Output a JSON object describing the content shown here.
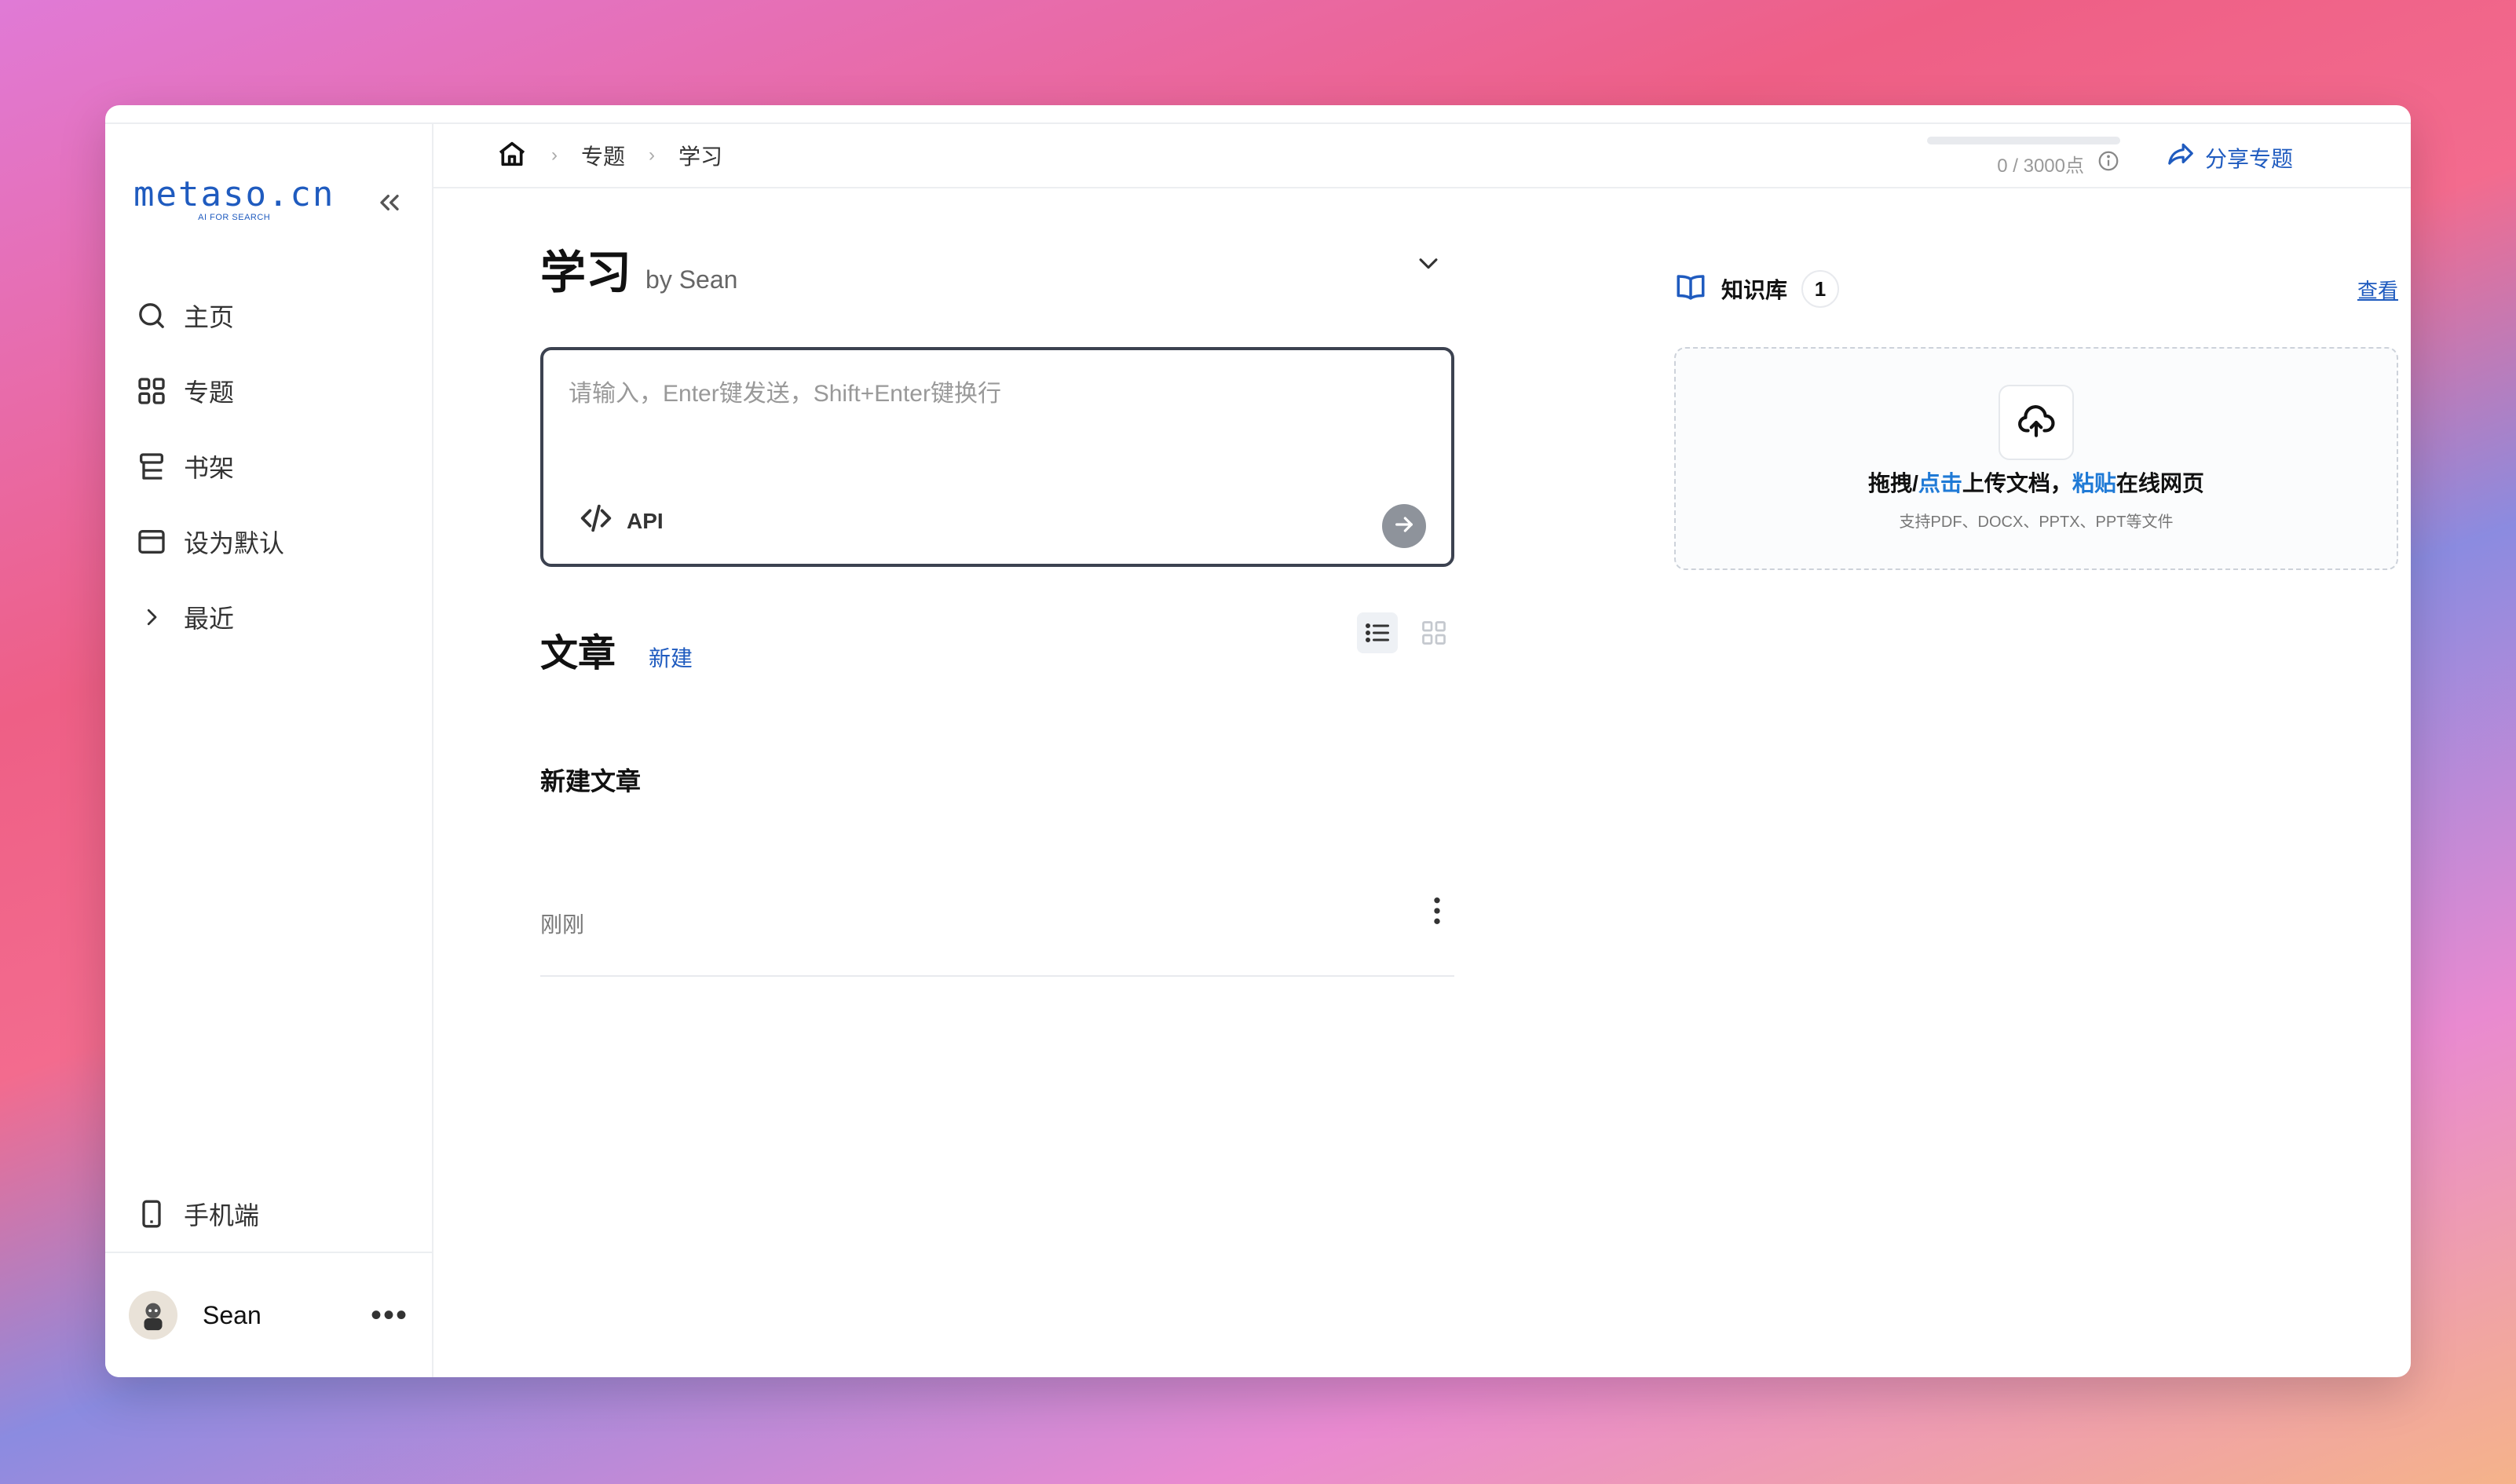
{
  "sidebar": {
    "logo": "metaso.cn",
    "logo_sub": "AI FOR SEARCH",
    "nav": [
      {
        "label": "主页",
        "icon": "search-icon"
      },
      {
        "label": "专题",
        "icon": "grid-icon"
      },
      {
        "label": "书架",
        "icon": "bookshelf-icon"
      },
      {
        "label": "设为默认",
        "icon": "window-icon"
      },
      {
        "label": "最近",
        "icon": "chevron-right-icon"
      }
    ],
    "mobile": "手机端",
    "user": {
      "name": "Sean"
    }
  },
  "header": {
    "breadcrumb": [
      "专题",
      "学习"
    ],
    "quota": "0 / 3000点",
    "quota_progress": 0,
    "share": "分享专题"
  },
  "topic": {
    "title": "学习",
    "byline": "by Sean",
    "input_placeholder": "请输入，Enter键发送，Shift+Enter键换行",
    "api_label": "API"
  },
  "articles": {
    "section_title": "文章",
    "new_label": "新建",
    "items": [
      {
        "title": "新建文章",
        "time": "刚刚"
      }
    ]
  },
  "knowledge": {
    "title": "知识库",
    "count": "1",
    "view_label": "查看",
    "upload": {
      "part1": "拖拽/",
      "link1": "点击",
      "part2": "上传文档，",
      "link2": "粘贴",
      "part3": "在线网页",
      "sub": "支持PDF、DOCX、PPTX、PPT等文件"
    }
  },
  "colors": {
    "accent": "#1f5bbf",
    "link": "#1f7ad6"
  }
}
